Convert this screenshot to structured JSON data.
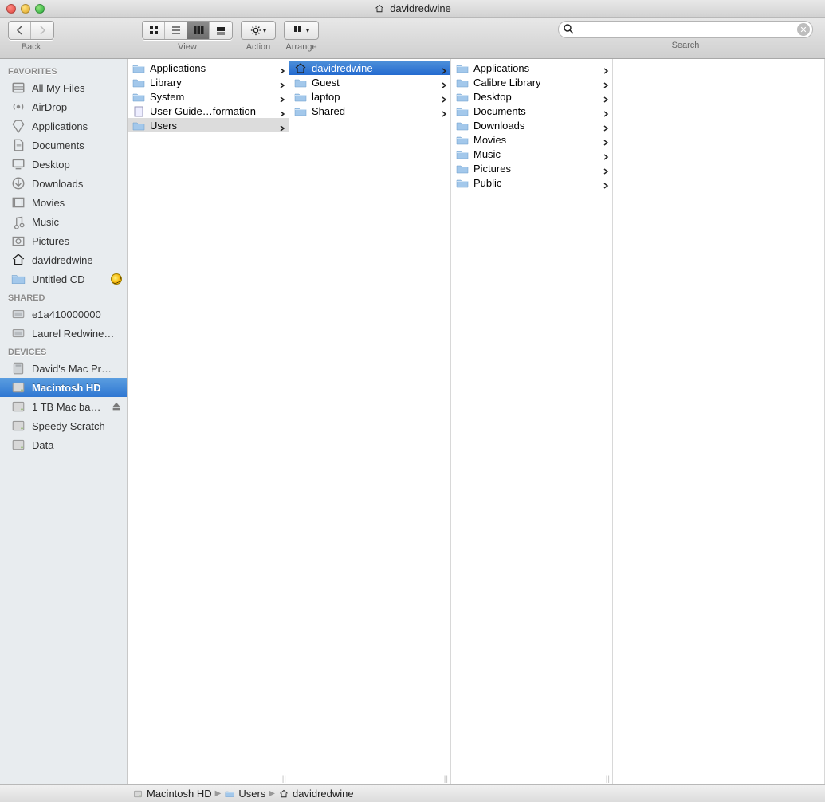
{
  "window": {
    "title": "davidredwine"
  },
  "toolbar": {
    "back_label": "Back",
    "view_label": "View",
    "action_label": "Action",
    "arrange_label": "Arrange",
    "search_label": "Search",
    "search_placeholder": ""
  },
  "sidebar": {
    "favorites_label": "FAVORITES",
    "shared_label": "SHARED",
    "devices_label": "DEVICES",
    "favorites": [
      {
        "icon": "all-my-files-icon",
        "label": "All My Files"
      },
      {
        "icon": "airdrop-icon",
        "label": "AirDrop"
      },
      {
        "icon": "applications-icon",
        "label": "Applications"
      },
      {
        "icon": "documents-icon",
        "label": "Documents"
      },
      {
        "icon": "desktop-icon",
        "label": "Desktop"
      },
      {
        "icon": "downloads-icon",
        "label": "Downloads"
      },
      {
        "icon": "movies-icon",
        "label": "Movies"
      },
      {
        "icon": "music-icon",
        "label": "Music"
      },
      {
        "icon": "pictures-icon",
        "label": "Pictures"
      },
      {
        "icon": "home-icon",
        "label": "davidredwine"
      },
      {
        "icon": "burn-folder-icon",
        "label": "Untitled CD",
        "trail": "burn"
      }
    ],
    "shared": [
      {
        "icon": "network-machine-icon",
        "label": "e1a410000000"
      },
      {
        "icon": "network-machine-icon",
        "label": "Laurel Redwine…"
      }
    ],
    "devices": [
      {
        "icon": "mac-pro-icon",
        "label": "David's Mac Pr…"
      },
      {
        "icon": "internal-disk-icon",
        "label": "Macintosh HD",
        "selected": true
      },
      {
        "icon": "external-disk-icon",
        "label": "1 TB Mac ba…",
        "trail": "eject"
      },
      {
        "icon": "external-disk-icon",
        "label": "Speedy Scratch"
      },
      {
        "icon": "external-disk-icon",
        "label": "Data"
      }
    ]
  },
  "columns": {
    "col1": [
      {
        "icon": "folder",
        "name": "Applications",
        "nav": true
      },
      {
        "icon": "folder",
        "name": "Library",
        "nav": true
      },
      {
        "icon": "folder",
        "name": "System",
        "nav": true
      },
      {
        "icon": "rtfd",
        "name": "User Guide…formation",
        "nav": true
      },
      {
        "icon": "folder",
        "name": "Users",
        "nav": true,
        "cellSelected": true
      }
    ],
    "col2": [
      {
        "icon": "home",
        "name": "davidredwine",
        "nav": true,
        "selected": true
      },
      {
        "icon": "folder",
        "name": "Guest",
        "nav": true
      },
      {
        "icon": "folder",
        "name": "laptop",
        "nav": true
      },
      {
        "icon": "folder",
        "name": "Shared",
        "nav": true
      }
    ],
    "col3": [
      {
        "icon": "folder",
        "name": "Applications",
        "nav": true
      },
      {
        "icon": "folder",
        "name": "Calibre Library",
        "nav": true
      },
      {
        "icon": "folder",
        "name": "Desktop",
        "nav": true
      },
      {
        "icon": "folder",
        "name": "Documents",
        "nav": true
      },
      {
        "icon": "folder",
        "name": "Downloads",
        "nav": true
      },
      {
        "icon": "folder",
        "name": "Movies",
        "nav": true
      },
      {
        "icon": "folder",
        "name": "Music",
        "nav": true
      },
      {
        "icon": "folder",
        "name": "Pictures",
        "nav": true
      },
      {
        "icon": "folder",
        "name": "Public",
        "nav": true
      }
    ]
  },
  "pathbar": [
    {
      "icon": "disk",
      "label": "Macintosh HD"
    },
    {
      "icon": "folder",
      "label": "Users"
    },
    {
      "icon": "home",
      "label": "davidredwine"
    }
  ]
}
